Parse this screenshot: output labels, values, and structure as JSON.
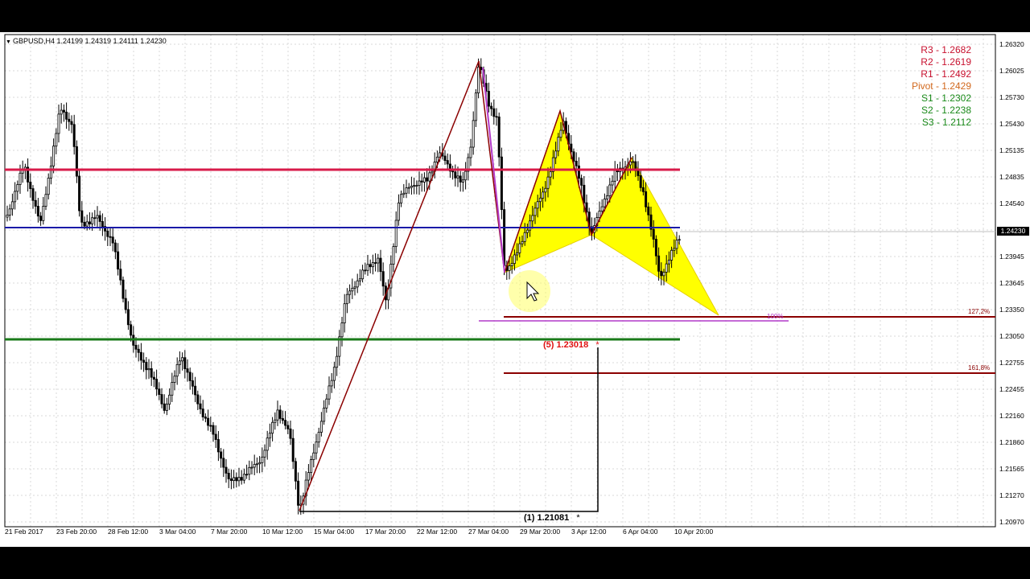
{
  "header": {
    "symbol": "GBPUSD,H4",
    "ohlc": "1.24199 1.24319 1.24111 1.24230"
  },
  "pivots": [
    {
      "label": "R3 - 1.2682",
      "color": "#c8102e"
    },
    {
      "label": "R2 - 1.2619",
      "color": "#c8102e"
    },
    {
      "label": "R1 - 1.2492",
      "color": "#c8102e"
    },
    {
      "label": "Pivot - 1.2429",
      "color": "#d2691e"
    },
    {
      "label": "S1 - 1.2302",
      "color": "#1a8a1a"
    },
    {
      "label": "S2 - 1.2238",
      "color": "#1a8a1a"
    },
    {
      "label": "S3 - 1.2112",
      "color": "#1a8a1a"
    }
  ],
  "price_axis": [
    "1.26320",
    "1.26025",
    "1.25730",
    "1.25430",
    "1.25135",
    "1.24835",
    "1.24540",
    "1.24230",
    "1.23945",
    "1.23645",
    "1.23350",
    "1.23050",
    "1.22755",
    "1.22455",
    "1.22160",
    "1.21860",
    "1.21565",
    "1.21270",
    "1.20970"
  ],
  "current_price": "1.24230",
  "time_axis": [
    "21 Feb 2017",
    "23 Feb 20:00",
    "28 Feb 12:00",
    "3 Mar 04:00",
    "7 Mar 20:00",
    "10 Mar 12:00",
    "15 Mar 04:00",
    "17 Mar 20:00",
    "22 Mar 12:00",
    "27 Mar 04:00",
    "29 Mar 20:00",
    "3 Apr 12:00",
    "6 Apr 04:00",
    "10 Apr 20:00"
  ],
  "annotations": {
    "point5": "(5) 1.23018",
    "point1": "(1) 1.21081",
    "star": "*",
    "fib1272": "127,2%",
    "fib1618": "161,8%",
    "fib100": "100%"
  },
  "colors": {
    "r1_line": "#d81b4a",
    "pivot_line": "#1a1aa8",
    "s1_line": "#1a7a1a",
    "pattern_fill": "#ffff00",
    "zigzag": "#8b0000",
    "purple_leg": "#b23ac8",
    "fib_line": "#8b0000",
    "bull": "#ffffff",
    "bear": "#000000"
  },
  "ranges": {
    "price_max": 1.2632,
    "price_min": 1.2097
  }
}
